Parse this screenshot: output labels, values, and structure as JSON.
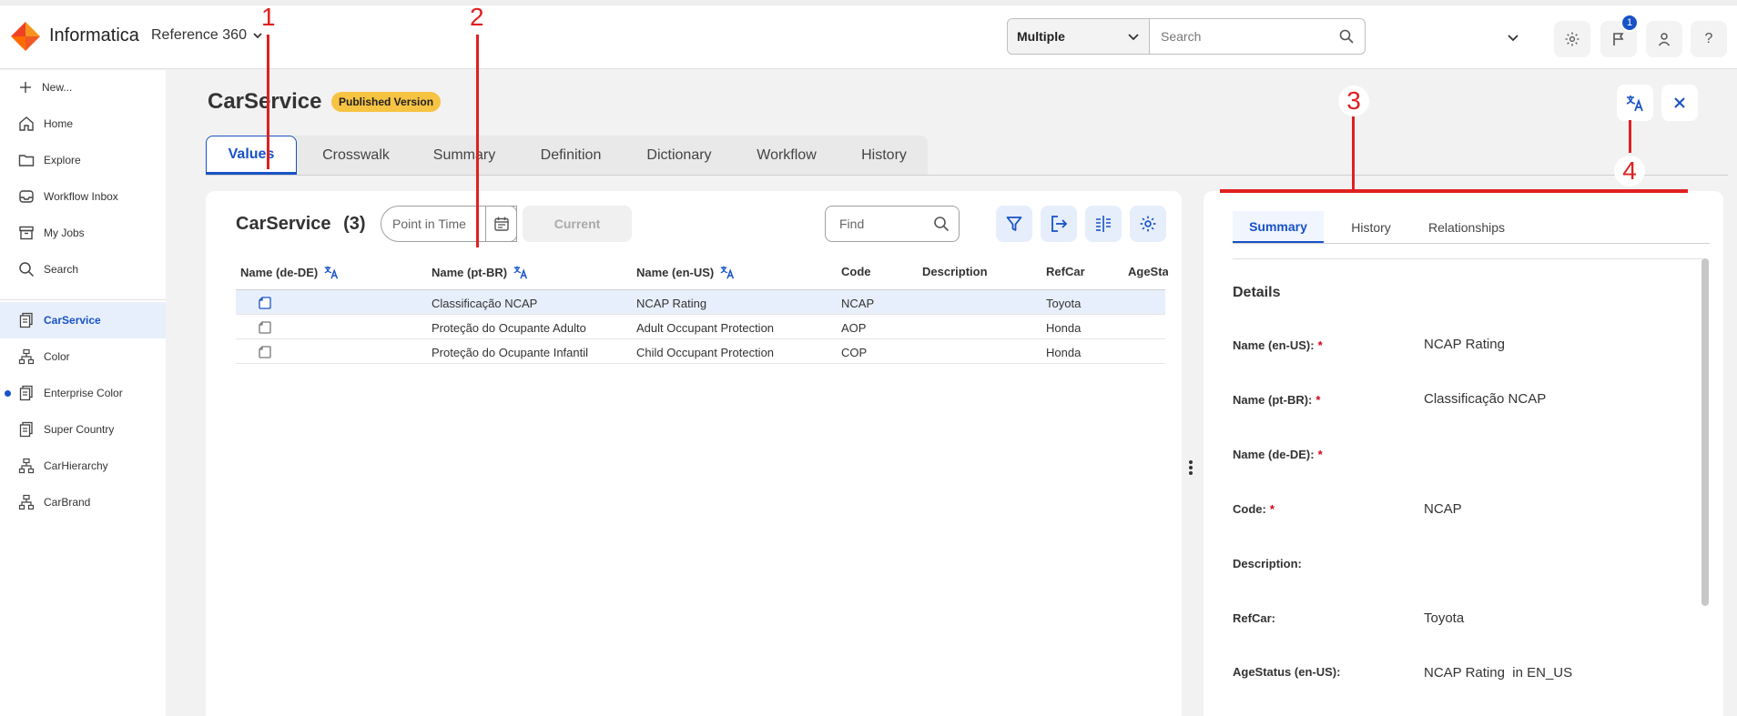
{
  "header": {
    "brand": "Informatica",
    "product": "Reference 360",
    "scope_select": "Multiple",
    "search_placeholder": "Search",
    "notification_count": "1",
    "help_label": "?"
  },
  "sidebar": {
    "items": [
      {
        "label": "New...",
        "icon": "plus-icon"
      },
      {
        "label": "Home",
        "icon": "home-icon"
      },
      {
        "label": "Explore",
        "icon": "folder-icon"
      },
      {
        "label": "Workflow Inbox",
        "icon": "inbox-icon"
      },
      {
        "label": "My Jobs",
        "icon": "archive-icon"
      },
      {
        "label": "Search",
        "icon": "search-icon"
      },
      {
        "label": "CarService",
        "icon": "document-stack-icon",
        "active": true
      },
      {
        "label": "Color",
        "icon": "hierarchy-icon"
      },
      {
        "label": "Enterprise Color",
        "icon": "document-stack-icon",
        "dot": true
      },
      {
        "label": "Super Country",
        "icon": "document-stack-icon"
      },
      {
        "label": "CarHierarchy",
        "icon": "hierarchy-icon"
      },
      {
        "label": "CarBrand",
        "icon": "hierarchy-icon"
      }
    ]
  },
  "page": {
    "title": "CarService",
    "badge": "Published Version",
    "tabs": [
      "Values",
      "Crosswalk",
      "Summary",
      "Definition",
      "Dictionary",
      "Workflow",
      "History"
    ]
  },
  "grid": {
    "title": "CarService",
    "count": "(3)",
    "point_in_time_placeholder": "Point in Time",
    "current_label": "Current",
    "find_placeholder": "Find",
    "columns": [
      "Name (de-DE)",
      "Name (pt-BR)",
      "Name (en-US)",
      "Code",
      "Description",
      "RefCar",
      "AgeSta"
    ],
    "rows": [
      {
        "de": "",
        "pt": "Classificação NCAP",
        "en": "NCAP Rating",
        "code": "NCAP",
        "desc": "",
        "refcar": "Toyota",
        "age": ""
      },
      {
        "de": "",
        "pt": "Proteção do Ocupante Adulto",
        "en": "Adult Occupant Protection",
        "code": "AOP",
        "desc": "",
        "refcar": "Honda",
        "age": ""
      },
      {
        "de": "",
        "pt": "Proteção do Ocupante Infantil",
        "en": "Child Occupant Protection",
        "code": "COP",
        "desc": "",
        "refcar": "Honda",
        "age": ""
      }
    ]
  },
  "panel": {
    "tabs": [
      "Summary",
      "History",
      "Relationships"
    ],
    "section": "Details",
    "fields": [
      {
        "label": "Name (en-US):",
        "required": true,
        "value": "NCAP Rating"
      },
      {
        "label": "Name (pt-BR):",
        "required": true,
        "value": "Classificação NCAP"
      },
      {
        "label": "Name (de-DE):",
        "required": true,
        "value": ""
      },
      {
        "label": "Code:",
        "required": true,
        "value": "NCAP"
      },
      {
        "label": "Description:",
        "required": false,
        "value": ""
      },
      {
        "label": "RefCar:",
        "required": false,
        "value": "Toyota"
      },
      {
        "label": "AgeStatus (en-US):",
        "required": false,
        "value": "NCAP Rating  in EN_US"
      }
    ],
    "required_mark": "*"
  },
  "annotations": [
    "1",
    "2",
    "3",
    "4"
  ],
  "colors": {
    "accent": "#1852c6",
    "annotation": "#e02020",
    "badge": "#f7c343"
  }
}
